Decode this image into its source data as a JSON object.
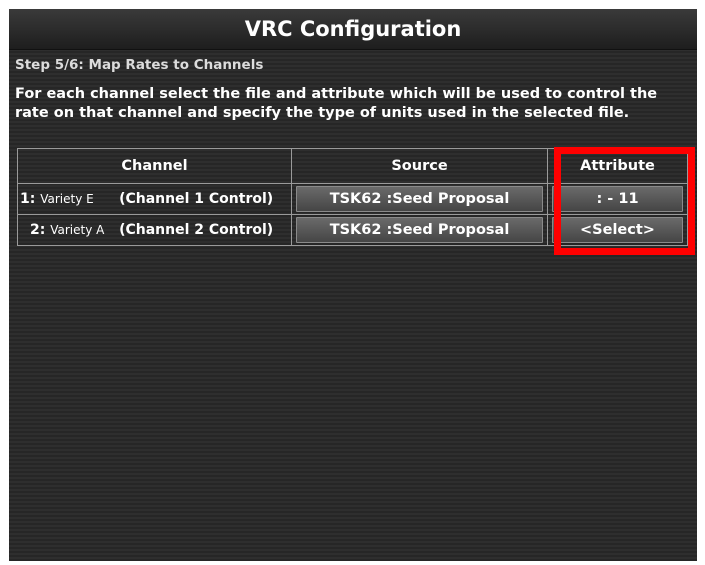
{
  "window": {
    "title": "VRC Configuration"
  },
  "step": {
    "label": "Step 5/6: Map Rates to Channels"
  },
  "instructions": "For each channel select the file and attribute which will be used to control the rate on that channel and specify the type of units used in the selected file.",
  "table": {
    "headers": {
      "channel": "Channel",
      "source": "Source",
      "attribute": "Attribute"
    },
    "rows": [
      {
        "num": "1:",
        "variety": "Variety E",
        "channel": "(Channel 1 Control)",
        "source": "TSK62 :Seed Proposal",
        "attribute": ": - 11"
      },
      {
        "num": "2:",
        "variety": "Variety A",
        "channel": "(Channel 2 Control)",
        "source": "TSK62 :Seed Proposal",
        "attribute": "<Select>"
      }
    ]
  },
  "colors": {
    "highlight": "#ff0000",
    "background": "#282828",
    "button": "#555555"
  }
}
